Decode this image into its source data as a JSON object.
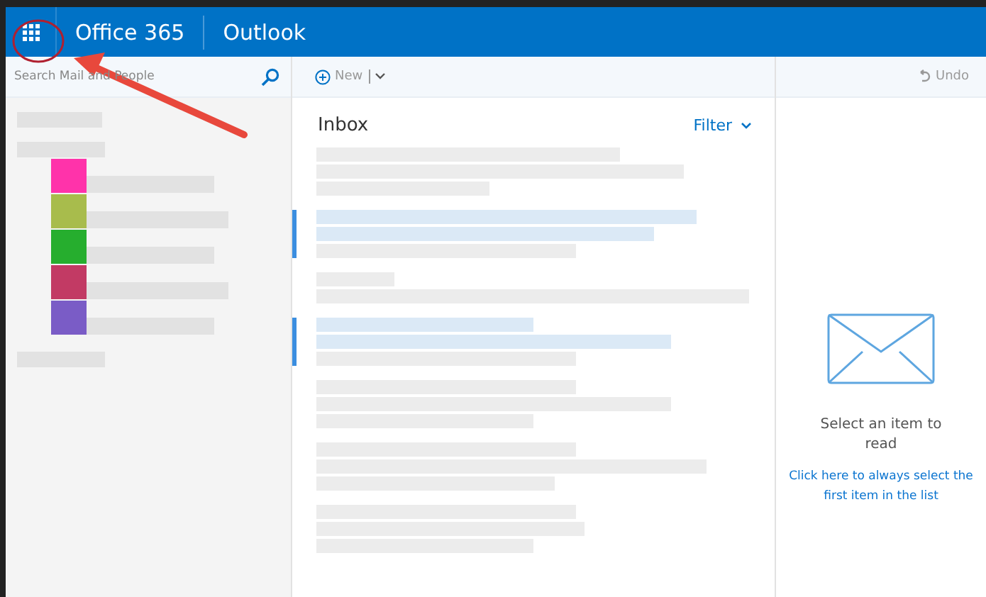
{
  "header": {
    "brand": "Office 365",
    "app": "Outlook"
  },
  "search": {
    "placeholder": "Search Mail and People"
  },
  "toolbar": {
    "new_label": "New",
    "undo_label": "Undo"
  },
  "folders": [
    {
      "color": "#ff33aa"
    },
    {
      "color": "#a8bc4c"
    },
    {
      "color": "#26ae2e"
    },
    {
      "color": "#c23a64"
    },
    {
      "color": "#7a5cc6"
    }
  ],
  "message_list": {
    "title": "Inbox",
    "filter_label": "Filter"
  },
  "messages": [
    {
      "unread": false
    },
    {
      "unread": true
    },
    {
      "unread": false
    },
    {
      "unread": true
    },
    {
      "unread": false
    },
    {
      "unread": false
    },
    {
      "unread": false
    }
  ],
  "reading_pane": {
    "message": "Select an item to read",
    "link": "Click here to always select the first item in the list"
  }
}
